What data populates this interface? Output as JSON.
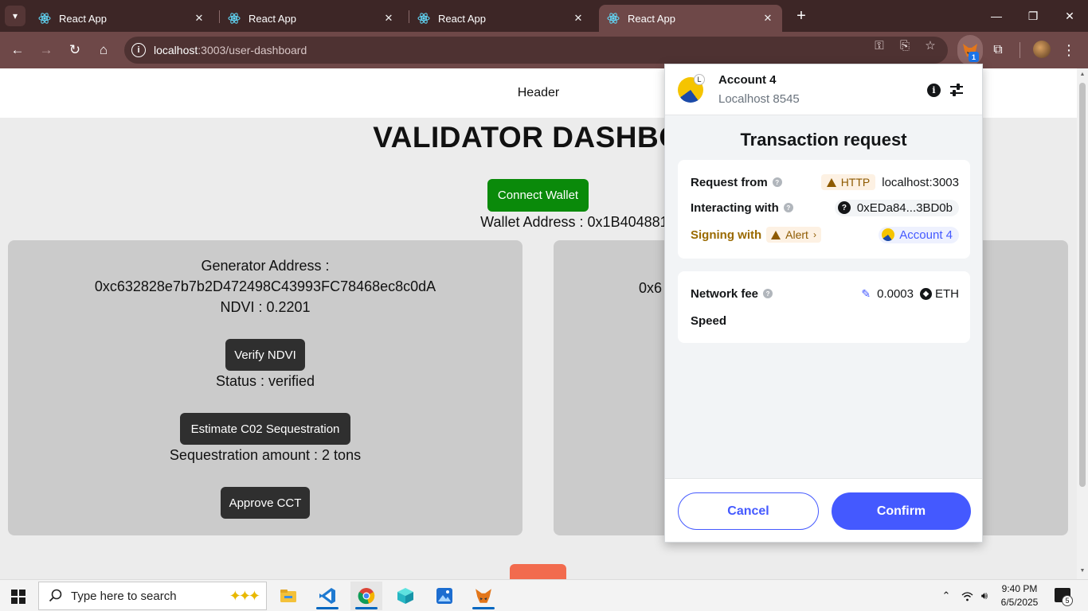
{
  "browser": {
    "tabs": [
      {
        "label": "React App",
        "close": "✕"
      },
      {
        "label": "React App",
        "close": "✕"
      },
      {
        "label": "React App",
        "close": "✕"
      },
      {
        "label": "React App",
        "close": "✕"
      }
    ],
    "new_tab": "+",
    "url_host": "localhost",
    "url_path": ":3003/user-dashboard",
    "extension_badge": "1",
    "icons": [
      "tab-search-icon",
      "react-icon",
      "close-icon",
      "plus-icon",
      "back-icon",
      "forward-icon",
      "reload-icon",
      "home-icon",
      "site-info-icon",
      "password-key-icon",
      "install-app-icon",
      "bookmark-star-icon",
      "metamask-fox-icon",
      "extensions-puzzle-icon",
      "profile-avatar",
      "more-menu-icon"
    ]
  },
  "page": {
    "header": "Header",
    "title": "VALIDATOR DASHBOA",
    "connect_wallet": "Connect Wallet",
    "wallet_address": "Wallet Address : 0x1B40488183363d0fa0a9d638fe36",
    "left_card": {
      "generator_label": "Generator Address :",
      "generator_address": "0xc632828e7b7b2D472498C43993FC78468ec8c0dA",
      "ndvi": "NDVI : 0.2201",
      "verify_button": "Verify NDVI",
      "status": "Status : verified",
      "estimate_button": "Estimate C02 Sequestration",
      "sequestration": "Sequestration amount : 2 tons",
      "approve_button": "Approve CCT"
    },
    "right_card": {
      "address_fragment": "0x6"
    }
  },
  "metamask": {
    "account": "Account 4",
    "network": "Localhost 8545",
    "avatar_badge": "L",
    "title": "Transaction request",
    "request_from_label": "Request from",
    "http_badge": "HTTP",
    "origin": "localhost:3003",
    "interacting_label": "Interacting with",
    "contract": "0xEDa84...3BD0b",
    "signing_label": "Signing with",
    "alert_label": "Alert",
    "signing_account": "Account 4",
    "network_fee_label": "Network fee",
    "fee_value": "0.0003",
    "fee_unit": "ETH",
    "speed_label": "Speed",
    "cancel": "Cancel",
    "confirm": "Confirm",
    "colors": {
      "primary": "#4459ff",
      "warning": "#8e5a00",
      "warning_bg": "#fdf1e3"
    }
  },
  "taskbar": {
    "search_placeholder": "Type here to search",
    "time": "9:40 PM",
    "date": "6/5/2025",
    "notification_count": "5",
    "apps": [
      "file-explorer-icon",
      "vscode-icon",
      "chrome-icon",
      "cube-app-icon",
      "photos-app-icon",
      "metamask-app-icon"
    ]
  }
}
